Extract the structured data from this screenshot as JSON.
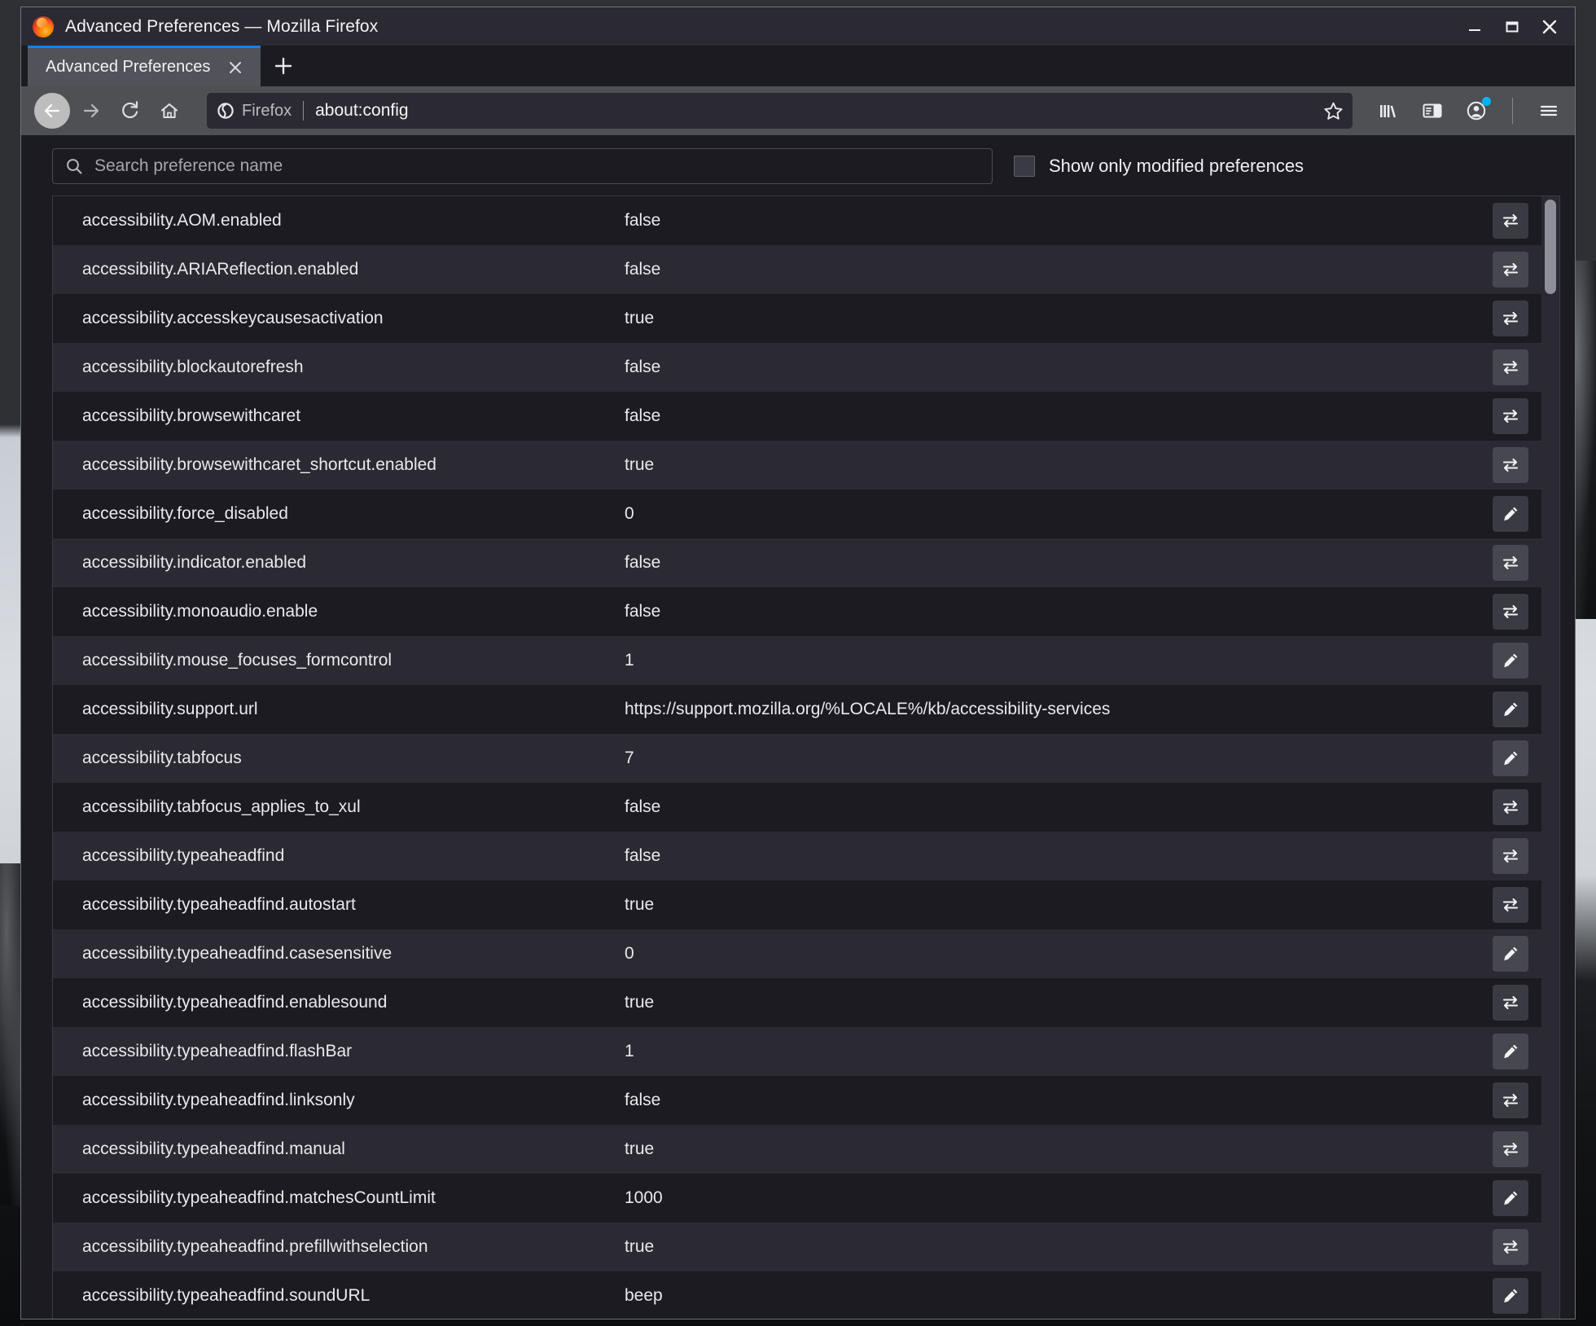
{
  "window": {
    "title": "Advanced Preferences — Mozilla Firefox",
    "logo_icon": "firefox-logo-icon",
    "controls": {
      "minimize": "minimize-icon",
      "maximize": "maximize-icon",
      "close": "close-icon"
    }
  },
  "tabs": {
    "items": [
      {
        "label": "Advanced Preferences",
        "close_icon": "close-icon",
        "active": true
      }
    ],
    "new_tab_icon": "plus-icon"
  },
  "nav": {
    "back_icon": "back-arrow-icon",
    "forward_icon": "forward-arrow-icon",
    "reload_icon": "reload-icon",
    "home_icon": "home-icon",
    "identity_label": "Firefox",
    "identity_icon": "firefox-shield-icon",
    "url": "about:config",
    "bookmark_icon": "star-icon",
    "library_icon": "library-icon",
    "sidebar_icon": "sidebar-icon",
    "account_icon": "account-icon",
    "menu_icon": "hamburger-menu-icon"
  },
  "config": {
    "search_placeholder": "Search preference name",
    "search_value": "",
    "search_icon": "search-icon",
    "show_modified_label": "Show only modified preferences",
    "show_modified_checked": false,
    "toggle_icon": "toggle-arrows-icon",
    "edit_icon": "pencil-edit-icon",
    "rows": [
      {
        "name": "accessibility.AOM.enabled",
        "value": "false",
        "action": "toggle"
      },
      {
        "name": "accessibility.ARIAReflection.enabled",
        "value": "false",
        "action": "toggle"
      },
      {
        "name": "accessibility.accesskeycausesactivation",
        "value": "true",
        "action": "toggle"
      },
      {
        "name": "accessibility.blockautorefresh",
        "value": "false",
        "action": "toggle"
      },
      {
        "name": "accessibility.browsewithcaret",
        "value": "false",
        "action": "toggle"
      },
      {
        "name": "accessibility.browsewithcaret_shortcut.enabled",
        "value": "true",
        "action": "toggle"
      },
      {
        "name": "accessibility.force_disabled",
        "value": "0",
        "action": "edit"
      },
      {
        "name": "accessibility.indicator.enabled",
        "value": "false",
        "action": "toggle"
      },
      {
        "name": "accessibility.monoaudio.enable",
        "value": "false",
        "action": "toggle"
      },
      {
        "name": "accessibility.mouse_focuses_formcontrol",
        "value": "1",
        "action": "edit"
      },
      {
        "name": "accessibility.support.url",
        "value": "https://support.mozilla.org/%LOCALE%/kb/accessibility-services",
        "action": "edit"
      },
      {
        "name": "accessibility.tabfocus",
        "value": "7",
        "action": "edit"
      },
      {
        "name": "accessibility.tabfocus_applies_to_xul",
        "value": "false",
        "action": "toggle"
      },
      {
        "name": "accessibility.typeaheadfind",
        "value": "false",
        "action": "toggle"
      },
      {
        "name": "accessibility.typeaheadfind.autostart",
        "value": "true",
        "action": "toggle"
      },
      {
        "name": "accessibility.typeaheadfind.casesensitive",
        "value": "0",
        "action": "edit"
      },
      {
        "name": "accessibility.typeaheadfind.enablesound",
        "value": "true",
        "action": "toggle"
      },
      {
        "name": "accessibility.typeaheadfind.flashBar",
        "value": "1",
        "action": "edit"
      },
      {
        "name": "accessibility.typeaheadfind.linksonly",
        "value": "false",
        "action": "toggle"
      },
      {
        "name": "accessibility.typeaheadfind.manual",
        "value": "true",
        "action": "toggle"
      },
      {
        "name": "accessibility.typeaheadfind.matchesCountLimit",
        "value": "1000",
        "action": "edit"
      },
      {
        "name": "accessibility.typeaheadfind.prefillwithselection",
        "value": "true",
        "action": "toggle"
      },
      {
        "name": "accessibility.typeaheadfind.soundURL",
        "value": "beep",
        "action": "edit"
      }
    ]
  },
  "colors": {
    "accent": "#0a84ff",
    "row_odd": "#1c1b22",
    "row_even": "#2b2a33",
    "text": "#e9e9ed",
    "badge": "#00b3f4"
  }
}
